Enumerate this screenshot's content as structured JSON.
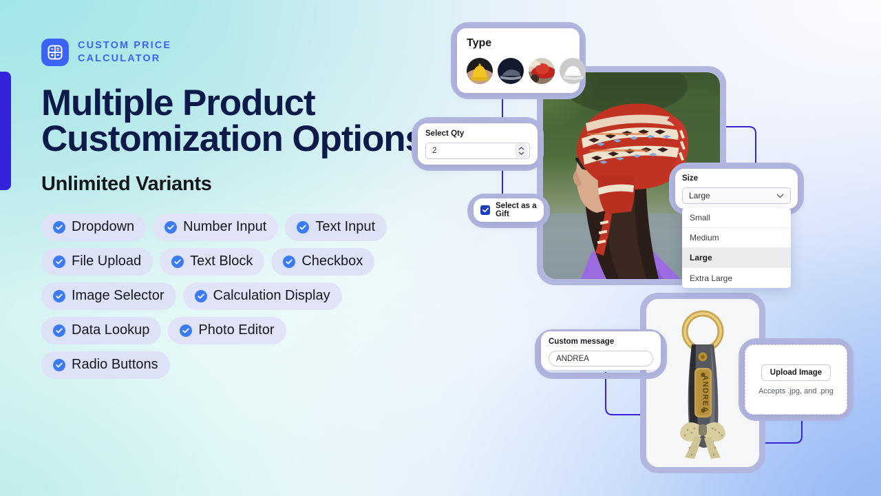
{
  "brand": {
    "line1": "CUSTOM PRICE",
    "line2": "CALCULATOR",
    "color": "#3b63f6",
    "logo_icon": "calculator-grid-icon"
  },
  "hero": {
    "headline": "Multiple Product Customization Options",
    "subheadline": "Unlimited Variants",
    "accent_color": "#3323dd",
    "headline_color": "#0d1a4a"
  },
  "features": {
    "check_color": "#3b7bf6",
    "rows": [
      [
        {
          "label": "Dropdown"
        },
        {
          "label": "Number Input"
        },
        {
          "label": "Text Input"
        }
      ],
      [
        {
          "label": "File Upload"
        },
        {
          "label": "Text Block"
        },
        {
          "label": "Checkbox"
        }
      ],
      [
        {
          "label": "Image Selector"
        },
        {
          "label": "Calculation Display"
        }
      ],
      [
        {
          "label": "Data Lookup"
        },
        {
          "label": "Photo Editor"
        }
      ],
      [
        {
          "label": "Radio Buttons"
        }
      ]
    ]
  },
  "widgets": {
    "type": {
      "label": "Type",
      "swatches": [
        {
          "name": "yellow-beanie-swatch"
        },
        {
          "name": "navy-cap-swatch"
        },
        {
          "name": "red-hat-swatch"
        },
        {
          "name": "white-cap-swatch"
        }
      ]
    },
    "qty": {
      "label": "Select Qty",
      "value": "2",
      "stepper_icon": "stepper-up-down-icon"
    },
    "gift": {
      "label": "Select as a Gift",
      "checked": true
    },
    "size": {
      "label": "Size",
      "value": "Large",
      "chevron_icon": "chevron-down-icon",
      "options": [
        "Small",
        "Medium",
        "Large",
        "Extra Large"
      ],
      "selected_option": "Large"
    },
    "message": {
      "label": "Custom message",
      "value": "ANDREA"
    },
    "upload": {
      "button_label": "Upload Image",
      "hint": "Accepts .jpg, and .png"
    }
  },
  "media": {
    "hat_photo_alt": "woman-wearing-knit-hat-photo",
    "keychain_photo_alt": "leather-keychain-andrea-photo",
    "keychain_engraving": "ANDREA"
  },
  "connector_color": "#3b22d8"
}
